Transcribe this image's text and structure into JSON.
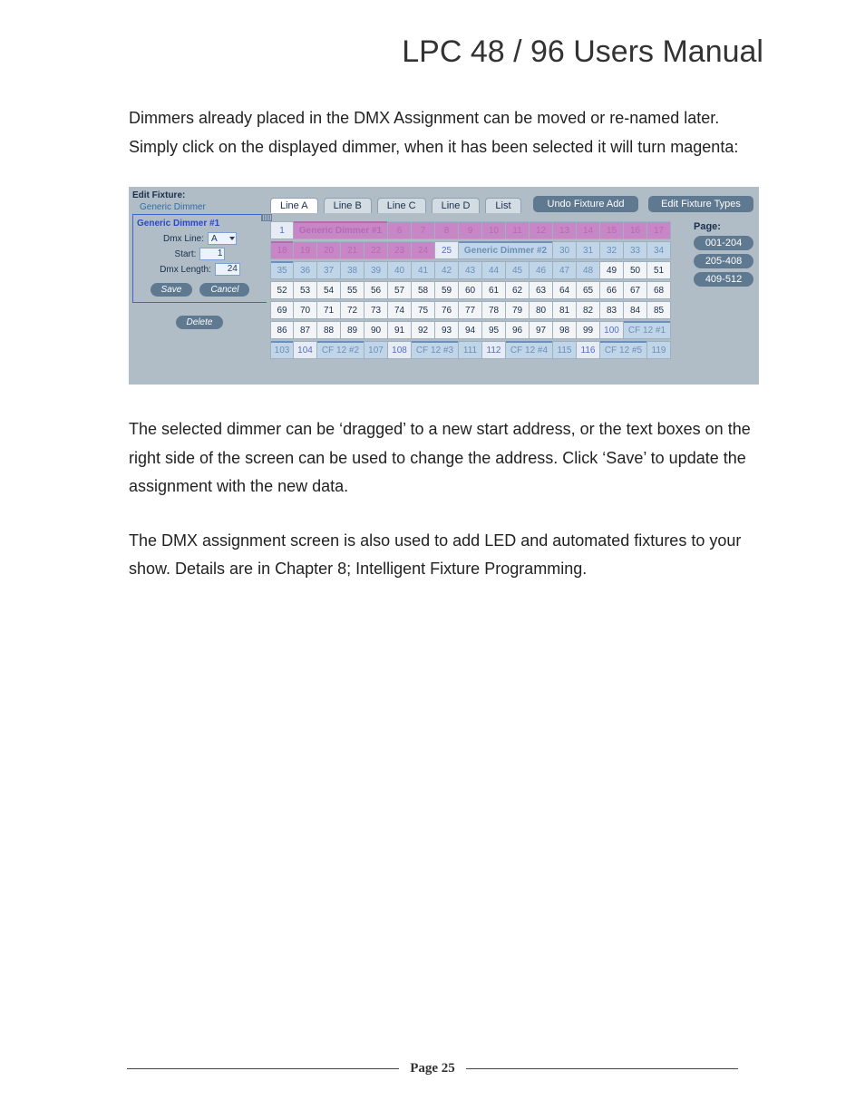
{
  "header": {
    "title": "LPC 48 / 96 Users Manual"
  },
  "paragraphs": {
    "p1": "Dimmers already placed in the DMX Assignment can be moved or re-named later.  Simply click on the displayed dimmer, when it has been selected it will turn magenta:",
    "p2": "The selected dimmer can be ‘dragged’ to a new start address, or the text boxes on the right side of the screen can be used to change the address.  Click ‘Save’ to update the assignment with the new data.",
    "p3": "The DMX assignment screen is also used to add LED and automated fixtures to your show. Details are in Chapter 8; Intelligent Fixture Programming."
  },
  "shot": {
    "editPanel": {
      "title": "Edit Fixture:",
      "sub": "Generic Dimmer",
      "selected": "Generic Dimmer #1",
      "dmxLineLabel": "Dmx Line:",
      "dmxLineValue": "A",
      "startLabel": "Start:",
      "startValue": "1",
      "lengthLabel": "Dmx Length:",
      "lengthValue": "24",
      "save": "Save",
      "cancel": "Cancel",
      "delete": "Delete"
    },
    "tabs": {
      "lineA": "Line A",
      "lineB": "Line B",
      "lineC": "Line C",
      "lineD": "Line D",
      "list": "List"
    },
    "buttons": {
      "undo": "Undo Fixture Add",
      "editTypes": "Edit Fixture Types"
    },
    "page": {
      "label": "Page:",
      "p1": "001-204",
      "p2": "205-408",
      "p3": "409-512"
    },
    "grid": {
      "dim1": "Generic Dimmer #1",
      "dim2": "Generic Dimmer #2",
      "cf1": "CF 12 #1",
      "cf2": "CF 12 #2",
      "cf3": "CF 12 #3",
      "cf4": "CF 12 #4",
      "cf5": "CF 12 #5",
      "r1": {
        "c1": "1",
        "c6": "6",
        "c7": "7",
        "c8": "8",
        "c9": "9",
        "c10": "10",
        "c11": "11",
        "c12": "12",
        "c13": "13",
        "c14": "14",
        "c15": "15",
        "c16": "16",
        "c17": "17"
      },
      "r2": {
        "c18": "18",
        "c19": "19",
        "c20": "20",
        "c21": "21",
        "c22": "22",
        "c23": "23",
        "c24": "24",
        "c25": "25",
        "c30": "30",
        "c31": "31",
        "c32": "32",
        "c33": "33",
        "c34": "34"
      },
      "r3": {
        "c35": "35",
        "c36": "36",
        "c37": "37",
        "c38": "38",
        "c39": "39",
        "c40": "40",
        "c41": "41",
        "c42": "42",
        "c43": "43",
        "c44": "44",
        "c45": "45",
        "c46": "46",
        "c47": "47",
        "c48": "48",
        "c49": "49",
        "c50": "50",
        "c51": "51"
      },
      "r4": {
        "c52": "52",
        "c53": "53",
        "c54": "54",
        "c55": "55",
        "c56": "56",
        "c57": "57",
        "c58": "58",
        "c59": "59",
        "c60": "60",
        "c61": "61",
        "c62": "62",
        "c63": "63",
        "c64": "64",
        "c65": "65",
        "c66": "66",
        "c67": "67",
        "c68": "68"
      },
      "r5": {
        "c69": "69",
        "c70": "70",
        "c71": "71",
        "c72": "72",
        "c73": "73",
        "c74": "74",
        "c75": "75",
        "c76": "76",
        "c77": "77",
        "c78": "78",
        "c79": "79",
        "c80": "80",
        "c81": "81",
        "c82": "82",
        "c83": "83",
        "c84": "84",
        "c85": "85"
      },
      "r6": {
        "c86": "86",
        "c87": "87",
        "c88": "88",
        "c89": "89",
        "c90": "90",
        "c91": "91",
        "c92": "92",
        "c93": "93",
        "c94": "94",
        "c95": "95",
        "c96": "96",
        "c97": "97",
        "c98": "98",
        "c99": "99",
        "c100": "100"
      },
      "r7": {
        "c103": "103",
        "c104": "104",
        "c107": "107",
        "c108": "108",
        "c111": "111",
        "c112": "112",
        "c115": "115",
        "c116": "116",
        "c119": "119"
      }
    }
  },
  "footer": {
    "page": "Page 25"
  }
}
